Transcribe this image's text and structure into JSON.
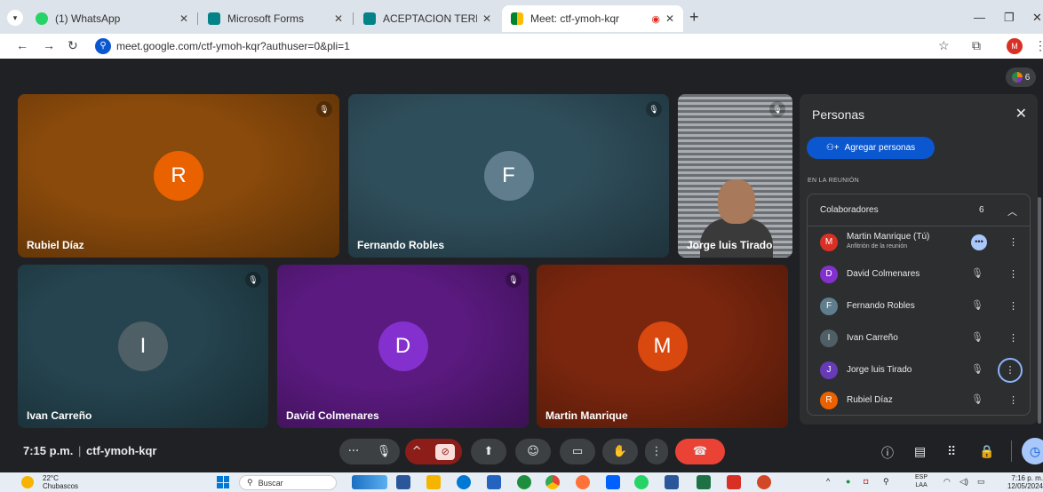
{
  "browser": {
    "tabs": [
      {
        "title": "(1) WhatsApp",
        "favicon_color": "#25d366"
      },
      {
        "title": "Microsoft Forms",
        "favicon_color": "#038387"
      },
      {
        "title": "ACEPTACION TERMINOS Y CON",
        "favicon_color": "#038387"
      },
      {
        "title": "Meet: ctf-ymoh-kqr",
        "favicon_color": "#00832d"
      }
    ],
    "url": "meet.google.com/ctf-ymoh-kqr?authuser=0&pli=1",
    "profile_initial": "M"
  },
  "meet": {
    "participant_badge_count": "6",
    "tiles": [
      {
        "name": "Rubiel Díaz",
        "initial": "R",
        "bg": "#8a4a0b",
        "avatar_color": "#ea6100"
      },
      {
        "name": "Fernando Robles",
        "initial": "F",
        "bg": "#2f4e5b",
        "avatar_color": "#5f7d8c"
      },
      {
        "name": "Jorge luis Tirado",
        "initial": "",
        "bg": "#8e9297",
        "avatar_color": ""
      },
      {
        "name": "Ivan Carreño",
        "initial": "I",
        "bg": "#25444f",
        "avatar_color": "#4f5f66"
      },
      {
        "name": "David Colmenares",
        "initial": "D",
        "bg": "#5b1a80",
        "avatar_color": "#8430ce"
      },
      {
        "name": "Martin Manrique",
        "initial": "M",
        "bg": "#7a260e",
        "avatar_color": "#d9480f"
      }
    ],
    "time": "7:15 p.m.",
    "separator": "|",
    "meeting_code": "ctf-ymoh-kqr"
  },
  "people_panel": {
    "title": "Personas",
    "add_button_label": "Agregar personas",
    "section_label": "EN LA REUNIÓN",
    "group_label": "Colaboradores",
    "group_count": "6",
    "participants": [
      {
        "name": "Martin Manrique (Tú)",
        "subtitle": "Anfitrión de la reunión",
        "initial": "M",
        "color": "#d93025"
      },
      {
        "name": "David Colmenares",
        "subtitle": "",
        "initial": "D",
        "color": "#8430ce"
      },
      {
        "name": "Fernando Robles",
        "subtitle": "",
        "initial": "F",
        "color": "#5f7d8c"
      },
      {
        "name": "Ivan Carreño",
        "subtitle": "",
        "initial": "I",
        "color": "#4f5f66"
      },
      {
        "name": "Jorge luis Tirado",
        "subtitle": "",
        "initial": "J",
        "color": "#673ab7"
      },
      {
        "name": "Rubiel Díaz",
        "subtitle": "",
        "initial": "R",
        "color": "#ea6100"
      }
    ]
  },
  "taskbar": {
    "temperature": "22°C",
    "weather": "Chubascos",
    "search_placeholder": "Buscar",
    "lang_top": "ESP",
    "lang_bottom": "LAA",
    "clock_time": "7:16 p. m.",
    "clock_date": "12/05/2024"
  }
}
